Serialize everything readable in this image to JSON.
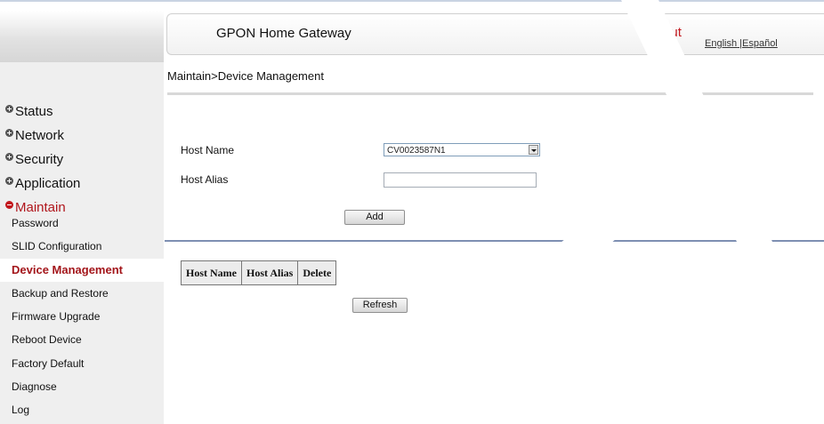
{
  "header": {
    "title": "GPON Home Gateway",
    "logout": "Logout",
    "lang_english": "English",
    "lang_separator": " |",
    "lang_spanish": "Español"
  },
  "sidebar": {
    "menu": [
      {
        "label": "Status",
        "state": "collapsed"
      },
      {
        "label": "Network",
        "state": "collapsed"
      },
      {
        "label": "Security",
        "state": "collapsed"
      },
      {
        "label": "Application",
        "state": "collapsed"
      },
      {
        "label": "Maintain",
        "state": "expanded"
      }
    ],
    "submenu": [
      {
        "label": "Password"
      },
      {
        "label": "SLID Configuration"
      },
      {
        "label": "Device Management",
        "active": true
      },
      {
        "label": "Backup and Restore"
      },
      {
        "label": "Firmware Upgrade"
      },
      {
        "label": "Reboot Device"
      },
      {
        "label": "Factory Default"
      },
      {
        "label": "Diagnose"
      },
      {
        "label": "Log"
      }
    ]
  },
  "breadcrumb": "Maintain>Device Management",
  "form": {
    "host_name_label": "Host Name",
    "host_name_value": "CV0023587N1",
    "host_alias_label": "Host Alias",
    "host_alias_value": "",
    "add_button": "Add"
  },
  "table": {
    "columns": [
      "Host Name",
      "Host Alias",
      "Delete"
    ],
    "rows": []
  },
  "refresh_button": "Refresh",
  "colors": {
    "accent_red": "#c2171d",
    "divider_blue": "#7e8fb2",
    "sidebar_bg": "#efefef"
  }
}
